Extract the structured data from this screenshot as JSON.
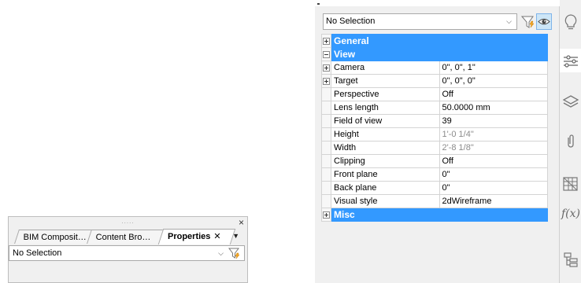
{
  "floating_panel": {
    "grip": ".....",
    "close_label": "×",
    "tabs": [
      {
        "label": "BIM Composit…"
      },
      {
        "label": "Content Bro…"
      },
      {
        "label": "Properties",
        "close": "✕"
      }
    ],
    "menu_label": "▼",
    "selection": {
      "value": "No Selection",
      "caret": "⌵"
    }
  },
  "properties": {
    "selection": {
      "value": "No Selection",
      "caret": "⌵"
    },
    "categories": {
      "general": "General",
      "view": "View",
      "misc": "Misc"
    },
    "rows": [
      {
        "name": "Camera",
        "value": "0\", 0\", 1\""
      },
      {
        "name": "Target",
        "value": "0\", 0\", 0\""
      },
      {
        "name": "Perspective",
        "value": "Off"
      },
      {
        "name": "Lens length",
        "value": "50.0000 mm"
      },
      {
        "name": "Field of view",
        "value": "39"
      },
      {
        "name": "Height",
        "value": "1'-0 1/4\""
      },
      {
        "name": "Width",
        "value": "2'-8 1/8\""
      },
      {
        "name": "Clipping",
        "value": "Off"
      },
      {
        "name": "Front plane",
        "value": "0\""
      },
      {
        "name": "Back plane",
        "value": "0\""
      },
      {
        "name": "Visual style",
        "value": "2dWireframe"
      }
    ]
  },
  "side_strip": {
    "icons": [
      "lightbulb-icon",
      "properties-sliders-icon",
      "layers-icon",
      "attachments-icon",
      "tool-palette-icon",
      "fx-icon",
      "structure-icon"
    ],
    "fx_label": "f(x)"
  },
  "colors": {
    "category_header": "#3399ff",
    "panel_bg": "#f0f0f0",
    "eye_active": "#cde6f7"
  }
}
